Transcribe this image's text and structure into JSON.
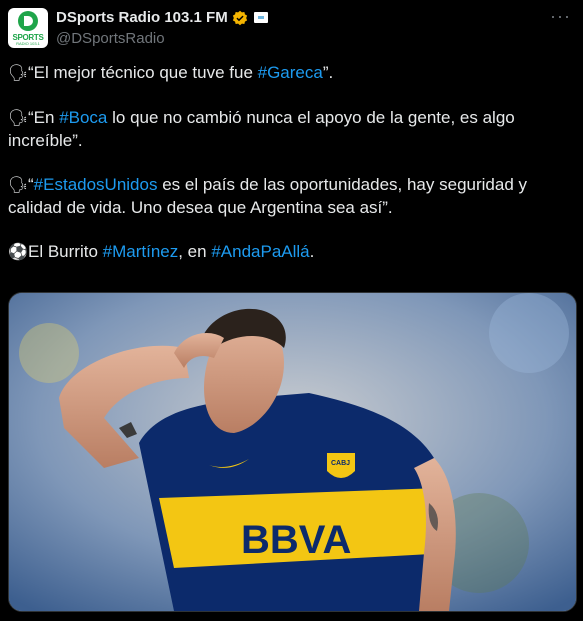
{
  "author": {
    "name": "DSports Radio 103.1 FM",
    "handle": "@DSportsRadio",
    "avatar_text": "SPORTS",
    "avatar_subtext": "RADIO 103.1"
  },
  "tweet": {
    "p1": {
      "emoji": "🗣",
      "pre": "“El mejor técnico que tuve fue ",
      "tag": "#Gareca",
      "post": "”."
    },
    "p2": {
      "emoji": "🗣",
      "pre": "“En ",
      "tag": "#Boca",
      "post": " lo que no cambió nunca el apoyo de la gente, es algo increíble”."
    },
    "p3": {
      "emoji": "🗣",
      "pre": "“",
      "tag": "#EstadosUnidos",
      "post": " es el país de las oportunidades, hay seguridad y calidad de vida. Uno desea que Argentina sea así”."
    },
    "p4": {
      "emoji": "⚽",
      "pre": "El Burrito ",
      "tag1": "#Martínez",
      "mid": ", en ",
      "tag2": "#AndaPaAllá",
      "post": "."
    }
  },
  "media": {
    "jersey_text": "BBVA",
    "badge_text": "CABJ"
  },
  "colors": {
    "background": "#000000",
    "text": "#e7e9ea",
    "secondary": "#71767b",
    "link": "#1d9bf0",
    "verified": "#f4b400",
    "boca_blue": "#0c2a6b",
    "boca_gold": "#f3c613"
  },
  "icons": {
    "verified": "verified-badge-icon",
    "affiliate": "affiliate-flag-icon",
    "more": "more-options-icon",
    "speaking": "speaking-head-icon",
    "ball": "soccer-ball-icon"
  }
}
